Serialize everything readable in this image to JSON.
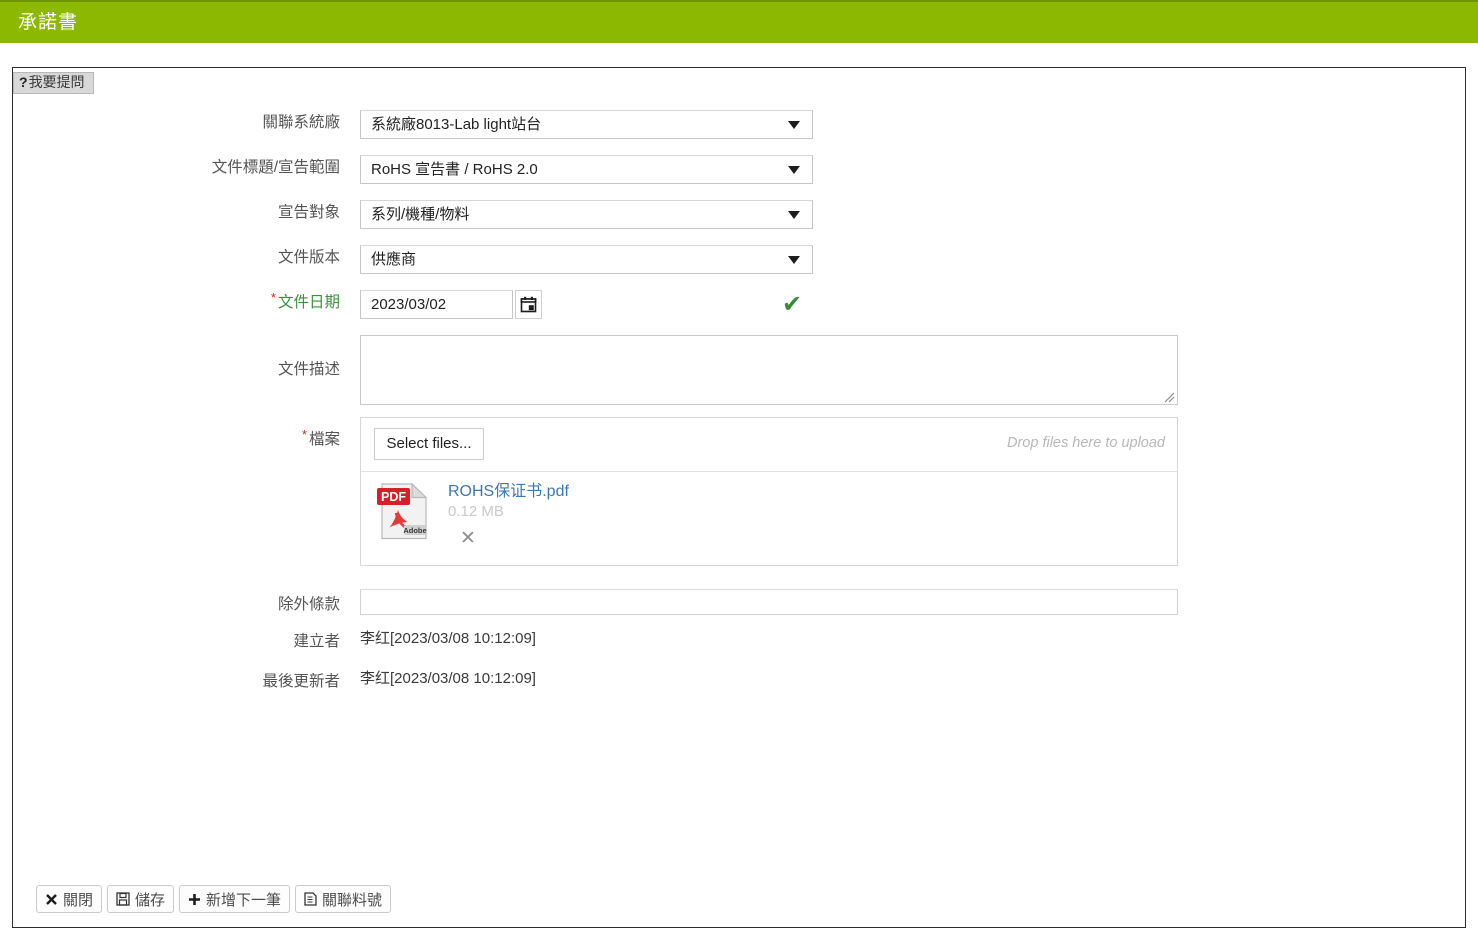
{
  "header": {
    "title": "承諾書",
    "bar_color": "#8cb802"
  },
  "ask_tab": {
    "icon": "question-mark-icon",
    "label": "我要提問"
  },
  "form": {
    "rows": [
      {
        "label": "關聯系統廠",
        "required": false,
        "type": "select",
        "value": "系統廠8013-Lab light站台"
      },
      {
        "label": "文件標題/宣告範圍",
        "required": false,
        "type": "select",
        "value": "RoHS 宣告書 / RoHS 2.0"
      },
      {
        "label": "宣告對象",
        "required": false,
        "type": "select",
        "value": "系列/機種/物料"
      },
      {
        "label": "文件版本",
        "required": false,
        "type": "select",
        "value": "供應商"
      },
      {
        "label": "文件日期",
        "required": true,
        "type": "date",
        "value": "2023/03/02"
      },
      {
        "label": "文件描述",
        "required": false,
        "type": "textarea",
        "value": ""
      },
      {
        "label": "檔案",
        "required": true,
        "type": "upload",
        "value": ""
      },
      {
        "label": "除外條款",
        "required": false,
        "type": "text",
        "value": ""
      },
      {
        "label": "建立者",
        "required": false,
        "type": "static",
        "value": "李红[2023/03/08 10:12:09]"
      },
      {
        "label": "最後更新者",
        "required": false,
        "type": "static",
        "value": "李红[2023/03/08 10:12:09]"
      }
    ],
    "required_marker": "*",
    "date_valid_icon": "check-icon"
  },
  "upload": {
    "select_files_label": "Select files...",
    "drop_hint": "Drop files here to upload",
    "files": [
      {
        "icon": "pdf-file-icon",
        "name": "ROHS保证书.pdf",
        "size": "0.12 MB",
        "remove_icon": "close-icon"
      }
    ]
  },
  "toolbar": {
    "buttons": [
      {
        "icon": "close-x-icon",
        "glyph": "✖",
        "label": "關閉"
      },
      {
        "icon": "save-floppy-icon",
        "glyph": "💾",
        "label": "儲存"
      },
      {
        "icon": "plus-icon",
        "glyph": "✚",
        "label": "新增下一筆"
      },
      {
        "icon": "document-icon",
        "glyph": "📄",
        "label": "關聯料號"
      }
    ]
  },
  "colors": {
    "accent_green": "#8cb802",
    "valid_green": "#3b8a3b",
    "required_red": "#e02020",
    "link_blue": "#3c78b4"
  }
}
